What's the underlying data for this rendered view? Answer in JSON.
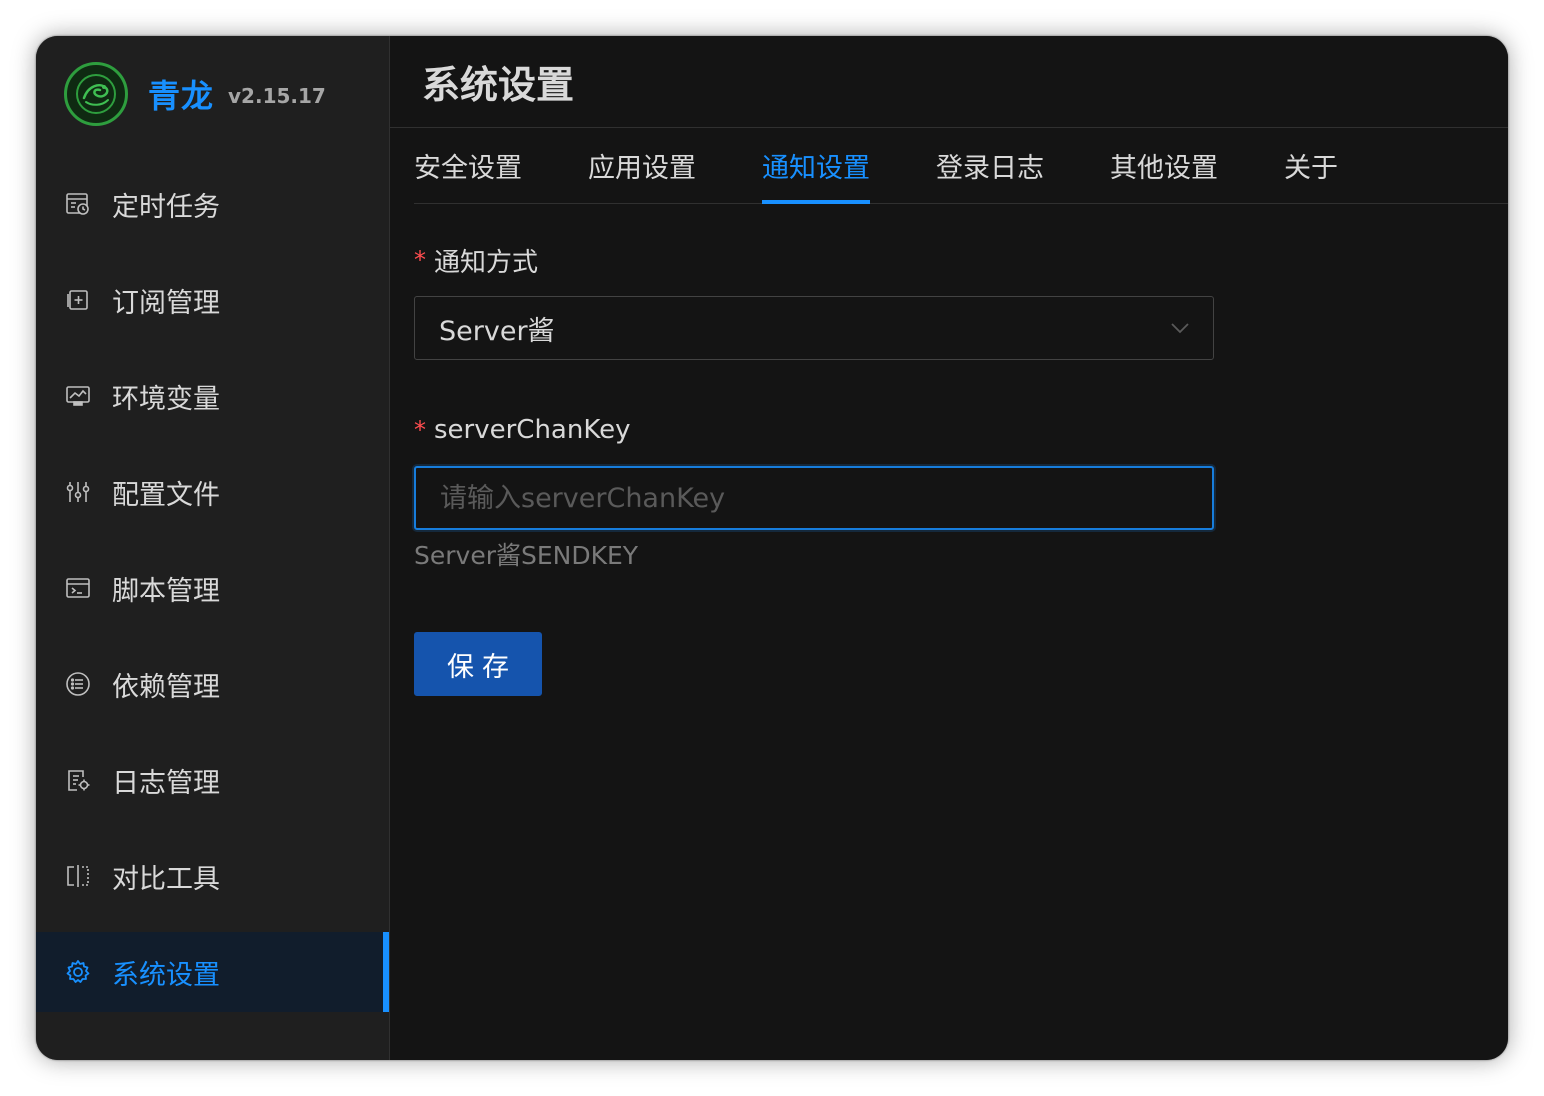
{
  "brand": {
    "name": "青龙",
    "version": "v2.15.17"
  },
  "sidebar": {
    "items": [
      {
        "label": "定时任务",
        "icon": "calendar-clock-icon"
      },
      {
        "label": "订阅管理",
        "icon": "subscription-icon"
      },
      {
        "label": "环境变量",
        "icon": "monitor-icon"
      },
      {
        "label": "配置文件",
        "icon": "sliders-icon"
      },
      {
        "label": "脚本管理",
        "icon": "terminal-window-icon"
      },
      {
        "label": "依赖管理",
        "icon": "list-circle-icon"
      },
      {
        "label": "日志管理",
        "icon": "log-file-icon"
      },
      {
        "label": "对比工具",
        "icon": "diff-icon"
      },
      {
        "label": "系统设置",
        "icon": "gear-icon",
        "active": true
      }
    ]
  },
  "header": {
    "title": "系统设置"
  },
  "tabs": [
    {
      "label": "安全设置"
    },
    {
      "label": "应用设置"
    },
    {
      "label": "通知设置",
      "active": true
    },
    {
      "label": "登录日志"
    },
    {
      "label": "其他设置"
    },
    {
      "label": "关于"
    }
  ],
  "form": {
    "notify_method": {
      "label": "通知方式",
      "value": "Server酱"
    },
    "server_chan_key": {
      "label": "serverChanKey",
      "value": "",
      "placeholder": "请输入serverChanKey",
      "help": "Server酱SENDKEY"
    },
    "save_label": "保存"
  },
  "colors": {
    "accent": "#1890ff",
    "required": "#ff4d4f",
    "button": "#1554ad",
    "background": "#141414",
    "sidebar": "#1f1f1f"
  }
}
